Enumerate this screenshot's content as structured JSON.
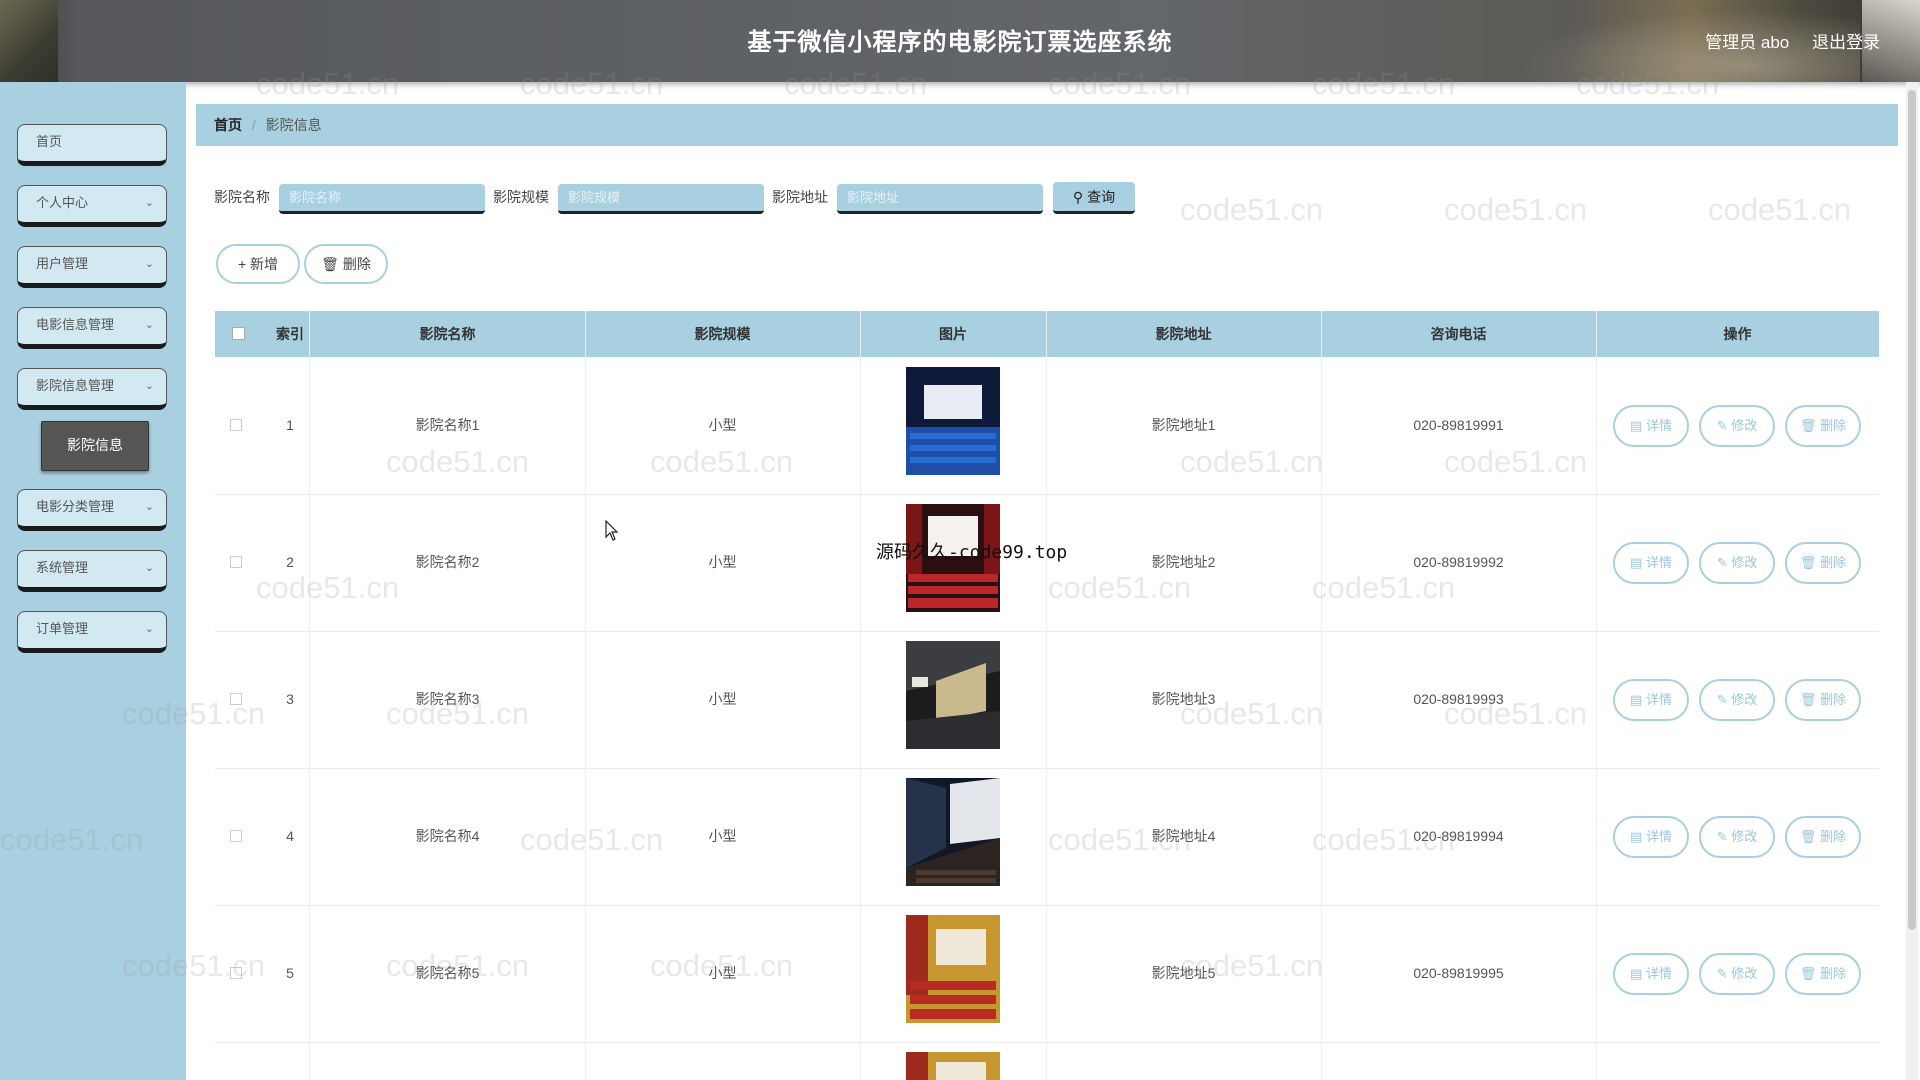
{
  "header": {
    "title": "基于微信小程序的电影院订票选座系统",
    "user_label": "管理员 abo",
    "logout_label": "退出登录"
  },
  "sidebar": {
    "items": [
      {
        "label": "首页"
      },
      {
        "label": "个人中心"
      },
      {
        "label": "用户管理"
      },
      {
        "label": "电影信息管理"
      },
      {
        "label": "影院信息管理"
      },
      {
        "label": "电影分类管理"
      },
      {
        "label": "系统管理"
      },
      {
        "label": "订单管理"
      }
    ],
    "active_sub": "影院信息"
  },
  "breadcrumb": {
    "home": "首页",
    "current": "影院信息"
  },
  "search": {
    "name_label": "影院名称",
    "name_placeholder": "影院名称",
    "scale_label": "影院规模",
    "scale_placeholder": "影院规模",
    "addr_label": "影院地址",
    "addr_placeholder": "影院地址",
    "query_label": "查询"
  },
  "actions": {
    "add_label": "新增",
    "delete_label": "删除"
  },
  "table": {
    "headers": [
      "索引",
      "影院名称",
      "影院规模",
      "图片",
      "影院地址",
      "咨询电话",
      "操作"
    ],
    "ops": {
      "detail": "详情",
      "edit": "修改",
      "delete": "删除"
    },
    "rows": [
      {
        "index": "1",
        "name": "影院名称1",
        "scale": "小型",
        "address": "影院地址1",
        "phone": "020-89819991"
      },
      {
        "index": "2",
        "name": "影院名称2",
        "scale": "小型",
        "address": "影院地址2",
        "phone": "020-89819992"
      },
      {
        "index": "3",
        "name": "影院名称3",
        "scale": "小型",
        "address": "影院地址3",
        "phone": "020-89819993"
      },
      {
        "index": "4",
        "name": "影院名称4",
        "scale": "小型",
        "address": "影院地址4",
        "phone": "020-89819994"
      },
      {
        "index": "5",
        "name": "影院名称5",
        "scale": "小型",
        "address": "影院地址5",
        "phone": "020-89819995"
      }
    ]
  },
  "watermark": {
    "text": "code51.cn",
    "overlay": "源码久久-code99.top"
  },
  "colors": {
    "accent": "#a9d0e0",
    "nav_bg": "#d2e9f2",
    "active_sub": "#555555"
  }
}
